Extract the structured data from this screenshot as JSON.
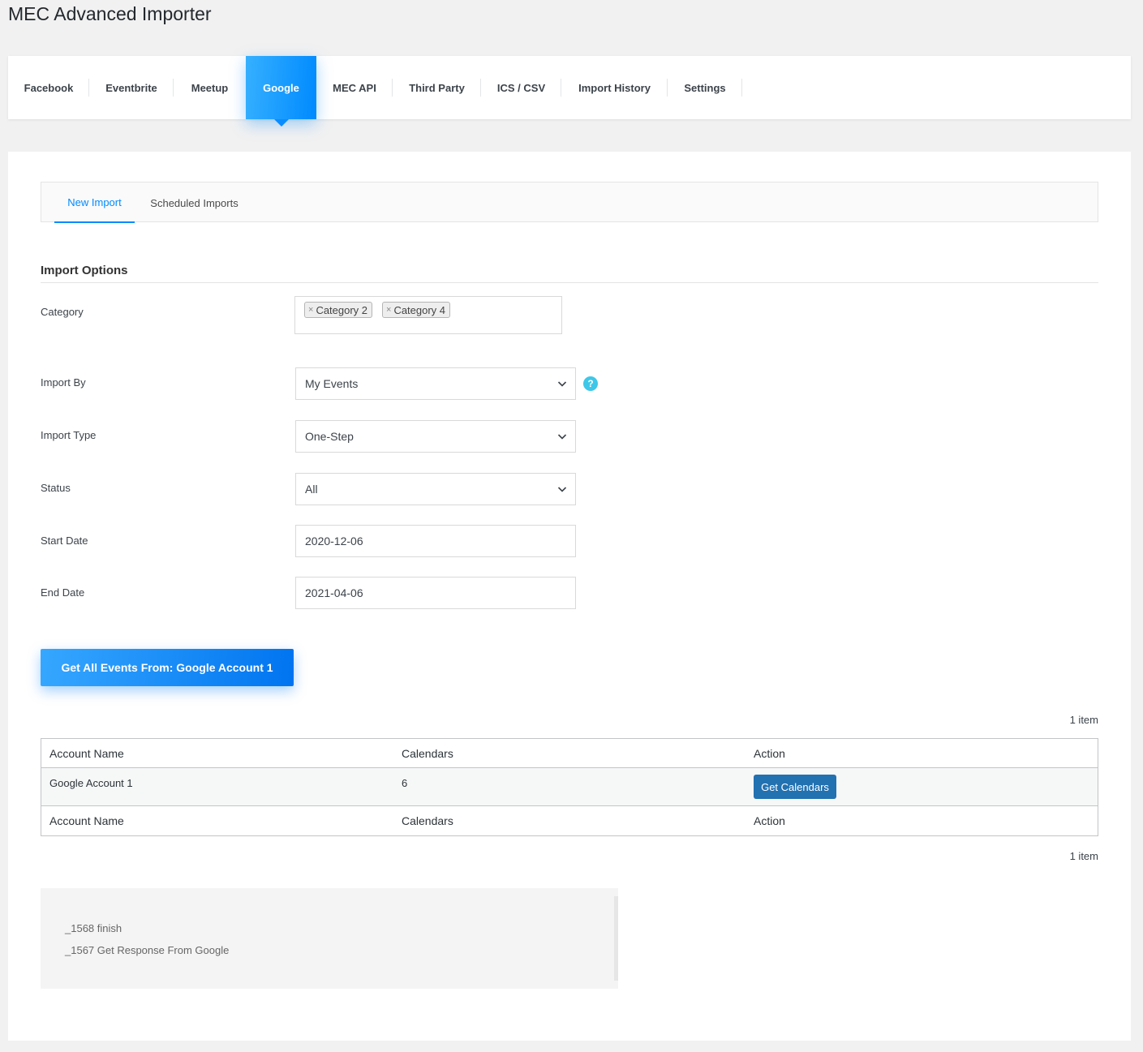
{
  "page": {
    "title": "MEC Advanced Importer"
  },
  "top_tabs": [
    {
      "label": "Facebook",
      "active": false
    },
    {
      "label": "Eventbrite",
      "active": false
    },
    {
      "label": "Meetup",
      "active": false
    },
    {
      "label": "Google",
      "active": true
    },
    {
      "label": "MEC API",
      "active": false
    },
    {
      "label": "Third Party",
      "active": false
    },
    {
      "label": "ICS / CSV",
      "active": false
    },
    {
      "label": "Import History",
      "active": false
    },
    {
      "label": "Settings",
      "active": false
    }
  ],
  "sub_tabs": [
    {
      "label": "New Import",
      "active": true
    },
    {
      "label": "Scheduled Imports",
      "active": false
    }
  ],
  "form": {
    "section_title": "Import Options",
    "category": {
      "label": "Category",
      "chips": [
        "Category 2",
        "Category 4"
      ],
      "remove_glyph": "×"
    },
    "import_by": {
      "label": "Import By",
      "value": "My Events",
      "help": "?"
    },
    "import_type": {
      "label": "Import Type",
      "value": "One-Step"
    },
    "status": {
      "label": "Status",
      "value": "All"
    },
    "start_date": {
      "label": "Start Date",
      "value": "2020-12-06"
    },
    "end_date": {
      "label": "End Date",
      "value": "2021-04-06"
    },
    "submit_label": "Get All Events From: Google Account 1"
  },
  "table": {
    "count_top": "1 item",
    "count_bottom": "1 item",
    "columns": [
      "Account Name",
      "Calendars",
      "Action"
    ],
    "rows": [
      {
        "account": "Google Account 1",
        "calendars": "6",
        "action": "Get Calendars"
      }
    ]
  },
  "log": {
    "lines": [
      "_1568 finish",
      "_1567 Get Response From Google"
    ]
  },
  "colors": {
    "accent": "#008aff",
    "button_blue": "#2271b1",
    "help_icon": "#3ec7e8"
  }
}
